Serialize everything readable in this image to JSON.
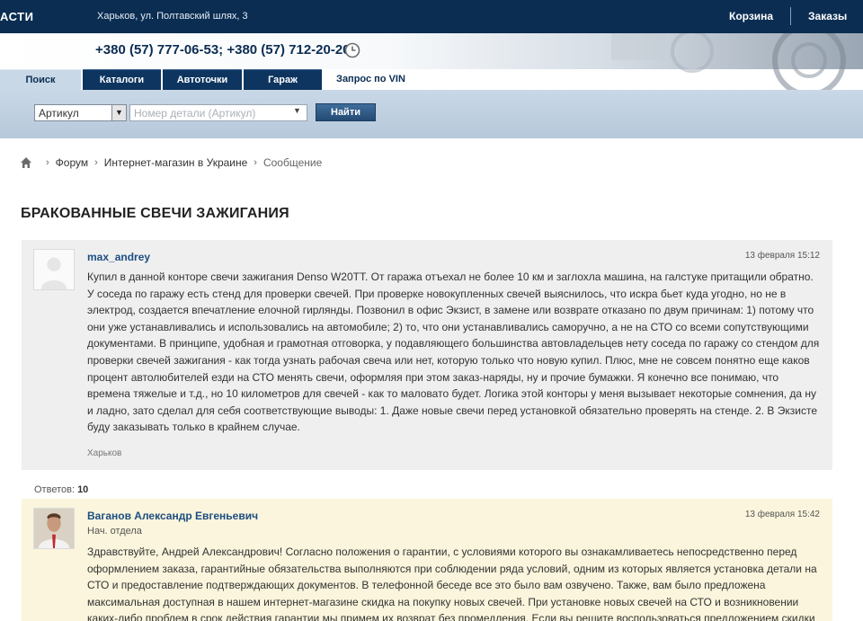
{
  "topbar": {
    "brand": "АСТИ",
    "address": "Харьков, ул. Полтавский шлях, 3",
    "cart": "Корзина",
    "orders": "Заказы"
  },
  "header": {
    "phones": "+380 (57) 777-06-53; +380 (57) 712-20-20",
    "clock_icon": "clock-icon"
  },
  "tabs": [
    {
      "label": "Поиск",
      "active": true
    },
    {
      "label": "Каталоги",
      "active": false
    },
    {
      "label": "Автоточки",
      "active": false
    },
    {
      "label": "Гараж",
      "active": false
    },
    {
      "label": "Запрос по VIN",
      "active": false
    }
  ],
  "search": {
    "type_value": "Артикул",
    "part_placeholder": "Номер детали (Артикул)",
    "button": "Найти"
  },
  "breadcrumb": {
    "home_icon": "home-icon",
    "items": [
      "Форум",
      "Интернет-магазин в Украине"
    ],
    "current": "Сообщение"
  },
  "page_title": "БРАКОВАННЫЕ СВЕЧИ ЗАЖИГАНИЯ",
  "posts": [
    {
      "author": "max_andrey",
      "date": "13 февраля 15:12",
      "text": "Купил в данной конторе свечи зажигания Denso W20TT. От гаража отъехал не более 10 км и заглохла машина, на галстуке притащили обратно. У соседа по гаражу есть стенд для проверки свечей. При проверке новокупленных свечей выяснилось, что искра бьет куда угодно, но не в электрод, создается впечатление елочной гирлянды. Позвонил в офис Экзист, в замене или возврате отказано по двум причинам: 1) потому что они уже устанавливались и использовались на автомобиле; 2) то, что они устанавливались саморучно, а не на СТО со всеми сопутствующими документами. В принципе, удобная и грамотная отговорка, у подавляющего большинства автовладельцев нету соседа по гаражу со стендом для проверки свечей зажигания - как тогда узнать рабочая свеча или нет, которую только что новую купил. Плюс, мне не совсем понятно еще каков процент автолюбителей езди на СТО менять свечи, оформляя при этом заказ-наряды, ну и прочие бумажки. Я конечно все понимаю, что времена тяжелые и т.д., но 10 километров для свечей - как то маловато будет. Логика этой конторы у меня вызывает некоторые сомнения, да ну и ладно, зато сделал для себя соответствующие выводы: 1. Даже новые свечи перед установкой обязательно проверять на стенде. 2. В Экзисте буду заказывать только в крайнем случае.",
      "city": "Харьков"
    },
    {
      "author": "Ваганов Александр Евгеньевич",
      "role": "Нач. отдела",
      "date": "13 февраля 15:42",
      "text": "Здравствуйте, Андрей Александрович!  Согласно положения о гарантии, с условиями которого вы ознакамливаетесь непосредственно перед оформлением заказа, гарантийные обязательства выполняются при соблюдении ряда условий, одним из которых является установка детали на СТО и предоставление подтверждающих документов. В телефонной беседе все это было вам озвучено. Также, вам было предложена максимальная доступная в нашем интернет-магазине скидка на покупку новых свечей. При установке новых свечей на СТО и возникновении каких-либо проблем в срок действия гарантии мы примем их возврат без промедления. Если вы решите воспользоваться предложением скидки на покупку свечей просьба"
    }
  ],
  "replies": {
    "label": "Ответов:",
    "count": "10"
  },
  "colors": {
    "topbar": "#0b2d52",
    "tab_dark": "#0d3560",
    "search_panel": "#c9d8e7",
    "post_bg": "#efefef",
    "reply_bg": "#faf5dc",
    "link": "#1d4e82"
  }
}
